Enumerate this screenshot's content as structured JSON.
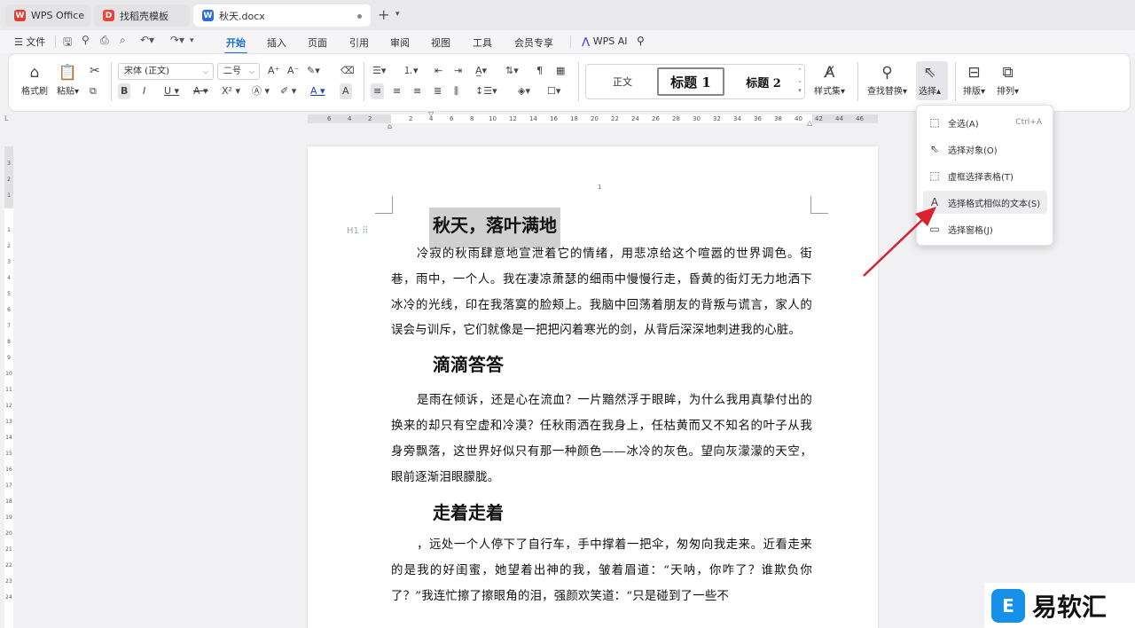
{
  "tabs": [
    {
      "label": "WPS Office",
      "icon": "wps-logo-icon"
    },
    {
      "label": "找稻壳模板",
      "icon": "docer-icon"
    },
    {
      "label": "秋天.docx",
      "icon": "word-doc-icon"
    }
  ],
  "menu": {
    "file": "文件",
    "items": [
      "开始",
      "插入",
      "页面",
      "引用",
      "审阅",
      "视图",
      "工具",
      "会员专享"
    ],
    "active": "开始",
    "wps_ai": "WPS AI"
  },
  "ribbon": {
    "format_painter": "格式刷",
    "paste": "粘贴",
    "font_name": "宋体 (正文)",
    "font_size": "二号",
    "styles": {
      "normal": "正文",
      "heading1": "标题 1",
      "heading2": "标题 2"
    },
    "style_set": "样式集",
    "find_replace": "查找替换",
    "select": "选择",
    "layout": "排版",
    "arrange": "排列"
  },
  "ruler": {
    "h_ticks": [
      "6",
      "4",
      "2",
      "",
      "2",
      "4",
      "6",
      "8",
      "10",
      "12",
      "14",
      "16",
      "18",
      "20",
      "22",
      "24",
      "26",
      "28",
      "30",
      "32",
      "34",
      "36",
      "38",
      "40",
      "42",
      "44",
      "46",
      "48"
    ],
    "v_ticks": [
      "3",
      "2",
      "1",
      "",
      "1",
      "2",
      "3",
      "4",
      "5",
      "6",
      "7",
      "8",
      "9",
      "10",
      "11",
      "12",
      "13",
      "14",
      "15",
      "16",
      "17",
      "18",
      "19",
      "20",
      "21",
      "22",
      "23",
      "24"
    ]
  },
  "document": {
    "page_number": "1",
    "heading_marker": "H1",
    "sections": [
      {
        "heading": "秋天，落叶满地",
        "paragraph": "冷寂的秋雨肆意地宣泄着它的情绪，用悲凉给这个喧嚣的世界调色。街巷，雨中，一个人。我在凄凉萧瑟的细雨中慢慢行走，昏黄的街灯无力地洒下冰冷的光线，印在我落寞的脸颊上。我脑中回荡着朋友的背叛与谎言，家人的误会与训斥，它们就像是一把把闪着寒光的剑，从背后深深地刺进我的心脏。"
      },
      {
        "heading": "滴滴答答",
        "paragraph": "是雨在倾诉，还是心在流血？一片黯然浮于眼眸，为什么我用真挚付出的换来的却只有空虚和冷漠？任秋雨洒在我身上，任枯黄而又不知名的叶子从我身旁飘落，这世界好似只有那一种颜色——冰冷的灰色。望向灰濛濛的天空，眼前逐渐泪眼朦胧。"
      },
      {
        "heading": "走着走着",
        "paragraph": "，远处一个人停下了自行车，手中撑着一把伞，匆匆向我走来。近看走来的是我的好闺蜜，她望着出神的我，皱着眉道：“天呐，你咋了？谁欺负你了？”我连忙擦了擦眼角的泪，强颜欢笑道：“只是碰到了一些不"
      }
    ]
  },
  "select_menu": {
    "items": [
      {
        "label": "全选(A)",
        "shortcut": "Ctrl+A",
        "icon": "select-all-icon"
      },
      {
        "label": "选择对象(O)",
        "shortcut": "",
        "icon": "select-object-icon"
      },
      {
        "label": "虚框选择表格(T)",
        "shortcut": "",
        "icon": "table-select-icon"
      },
      {
        "label": "选择格式相似的文本(S)",
        "shortcut": "",
        "icon": "similar-format-icon"
      },
      {
        "label": "选择窗格(J)",
        "shortcut": "",
        "icon": "selection-pane-icon"
      }
    ],
    "hover_index": 3
  },
  "watermark": {
    "text": "易软汇"
  },
  "colors": {
    "accent": "#1a6fd6",
    "arrow": "#d9232e",
    "wps_red": "#e23b30",
    "watermark_blue": "#1690e8"
  }
}
